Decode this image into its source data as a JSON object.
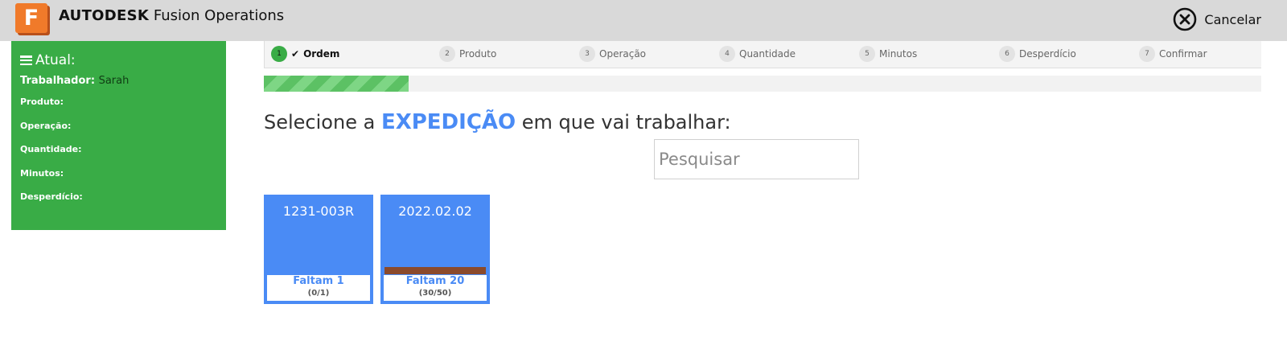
{
  "header": {
    "logo_letter": "F",
    "brand_strong": "AUTODESK",
    "brand_product": "Fusion Operations",
    "cancel_label": "Cancelar",
    "cancel_icon": "close-circle-icon"
  },
  "sidebar": {
    "title": "Atual:",
    "worker_label": "Trabalhador:",
    "worker_value": "Sarah",
    "fields": [
      "Produto:",
      "Operação:",
      "Quantidade:",
      "Minutos:",
      "Desperdício:"
    ]
  },
  "steps": [
    {
      "num": "1",
      "label": "Ordem",
      "active": true
    },
    {
      "num": "2",
      "label": "Produto"
    },
    {
      "num": "3",
      "label": "Operação"
    },
    {
      "num": "4",
      "label": "Quantidade"
    },
    {
      "num": "5",
      "label": "Minutos"
    },
    {
      "num": "6",
      "label": "Desperdício"
    },
    {
      "num": "7",
      "label": "Confirmar"
    }
  ],
  "progress": {
    "fraction": 0.145
  },
  "heading": {
    "prefix": "Selecione a",
    "emphasis": "EXPEDIÇÃO",
    "suffix": "em que vai trabalhar:"
  },
  "search": {
    "placeholder": "Pesquisar",
    "value": ""
  },
  "cards": [
    {
      "title": "1231-003R",
      "remaining": "Faltam 1",
      "count": "(0/1)",
      "has_bar": false
    },
    {
      "title": "2022.02.02",
      "remaining": "Faltam 20",
      "count": "(30/50)",
      "has_bar": true
    }
  ],
  "colors": {
    "accent_blue": "#4a8bf5",
    "sidebar_green": "#39ac46",
    "logo_orange": "#f07a2a",
    "bar_brown": "#8b4a2b"
  }
}
